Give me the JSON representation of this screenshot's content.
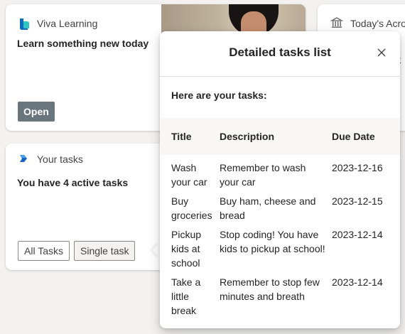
{
  "viva_card": {
    "app_name": "Viva Learning",
    "headline": "Learn something new today",
    "open_button": "Open"
  },
  "acronyms_card": {
    "app_name": "Today's Acronym",
    "partial_text": "it"
  },
  "tasks_card": {
    "app_name": "Your tasks",
    "headline": "You have 4 active tasks",
    "all_tasks_button": "All Tasks",
    "single_task_button": "Single task"
  },
  "popup": {
    "title": "Detailed tasks list",
    "intro": "Here are your tasks:",
    "columns": {
      "title": "Title",
      "description": "Description",
      "due_date": "Due Date"
    },
    "tasks": [
      {
        "title": "Wash your car",
        "description": "Remember to wash your car",
        "due_date": "2023-12-16"
      },
      {
        "title": "Buy groceries",
        "description": "Buy ham, cheese and bread",
        "due_date": "2023-12-15"
      },
      {
        "title": "Pickup kids at school",
        "description": "Stop coding! You have kids to pickup at school!",
        "due_date": "2023-12-14"
      },
      {
        "title": "Take a little break",
        "description": "Remember to stop few minutes and breath",
        "due_date": "2023-12-14"
      }
    ]
  }
}
